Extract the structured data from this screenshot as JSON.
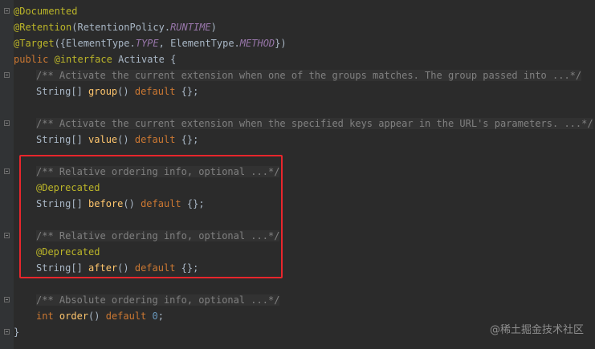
{
  "code": {
    "l1": {
      "ann": "@Documented"
    },
    "l2": {
      "ann": "@Retention",
      "open": "(RetentionPolicy.",
      "const": "RUNTIME",
      "close": ")"
    },
    "l3": {
      "ann": "@Target",
      "open": "({ElementType.",
      "const1": "TYPE",
      "mid": ", ElementType.",
      "const2": "METHOD",
      "close": "})"
    },
    "l4": {
      "kw": "public",
      "ann": "@interface",
      "name": "Activate",
      "brace": "{"
    },
    "l5": {
      "comment": "/** Activate the current extension when one of the groups matches. The group passed into ...*/"
    },
    "l6": {
      "type": "String[]",
      "fn": "group",
      "paren": "()",
      "kw": "default",
      "rest": "{};"
    },
    "l8": {
      "comment": "/** Activate the current extension when the specified keys appear in the URL's parameters. ...*/"
    },
    "l9": {
      "type": "String[]",
      "fn": "value",
      "paren": "()",
      "kw": "default",
      "rest": "{};"
    },
    "l11": {
      "comment": "/** Relative ordering info, optional ...*/"
    },
    "l12": {
      "ann": "@Deprecated"
    },
    "l13": {
      "type": "String[]",
      "fn": "before",
      "paren": "()",
      "kw": "default",
      "rest": "{};"
    },
    "l15": {
      "comment": "/** Relative ordering info, optional ...*/"
    },
    "l16": {
      "ann": "@Deprecated"
    },
    "l17": {
      "type": "String[]",
      "fn": "after",
      "paren": "()",
      "kw": "default",
      "rest": "{};"
    },
    "l19": {
      "comment": "/** Absolute ordering info, optional ...*/"
    },
    "l20": {
      "kw": "int",
      "fn": "order",
      "paren": "()",
      "kw2": "default",
      "num": "0",
      "semi": ";"
    },
    "l21": {
      "brace": "}"
    }
  },
  "watermark": "@稀土掘金技术社区",
  "colors": {
    "highlight_box": "#e8262c",
    "background": "#2b2b2b"
  }
}
